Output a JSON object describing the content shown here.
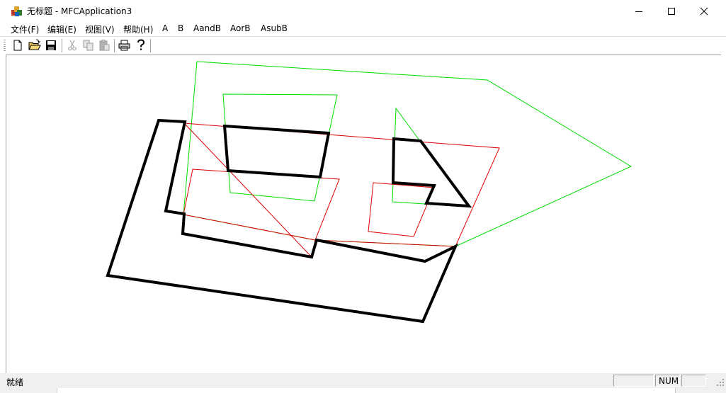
{
  "window": {
    "title": "无标题 - MFCApplication3",
    "controls": {
      "minimize": "minimize",
      "maximize": "maximize",
      "close": "close"
    }
  },
  "menubar": {
    "items": [
      "文件(F)",
      "编辑(E)",
      "视图(V)",
      "帮助(H)",
      "A",
      "B",
      "AandB",
      "AorB",
      "AsubB"
    ]
  },
  "toolbar": {
    "buttons": [
      "new-file-icon",
      "open-folder-icon",
      "save-icon",
      "cut-icon",
      "copy-icon",
      "paste-icon",
      "print-icon",
      "help-icon"
    ],
    "disabled": [
      "cut-icon",
      "copy-icon",
      "paste-icon"
    ]
  },
  "canvas": {
    "polygons": [
      {
        "name": "polygon-a-outer",
        "color": "#00dd00"
      },
      {
        "name": "polygon-a-hole-left",
        "color": "#00dd00"
      },
      {
        "name": "polygon-a-hole-triangle",
        "color": "#00dd00"
      },
      {
        "name": "polygon-b-outer",
        "color": "#dd0000"
      },
      {
        "name": "polygon-b-hole-left",
        "color": "#dd0000"
      },
      {
        "name": "polygon-b-hole-right",
        "color": "#dd0000"
      },
      {
        "name": "result-outer",
        "color": "#000000"
      },
      {
        "name": "result-hole-left",
        "color": "#000000"
      },
      {
        "name": "result-hole-right",
        "color": "#000000"
      }
    ]
  },
  "statusbar": {
    "text": "就绪",
    "indicators": [
      "",
      "NUM",
      ""
    ]
  }
}
